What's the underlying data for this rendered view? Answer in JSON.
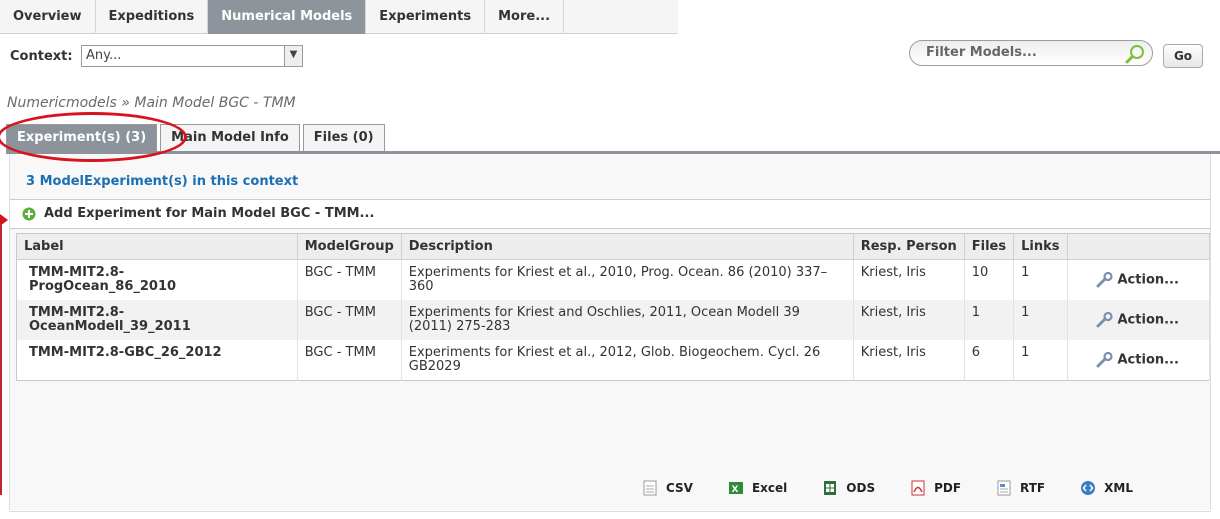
{
  "nav": {
    "tabs": [
      {
        "label": "Overview",
        "active": false
      },
      {
        "label": "Expeditions",
        "active": false
      },
      {
        "label": "Numerical Models",
        "active": true
      },
      {
        "label": "Experiments",
        "active": false
      },
      {
        "label": "More...",
        "active": false
      }
    ]
  },
  "context": {
    "label": "Context:",
    "selected": "Any...",
    "filter_placeholder": "Filter Models...",
    "go_label": "Go"
  },
  "breadcrumb": "Numericmodels » Main Model BGC - TMM",
  "subtabs": [
    {
      "label": "Experiment(s) (3)",
      "active": true
    },
    {
      "label": "Main Model Info",
      "active": false
    },
    {
      "label": "Files (0)",
      "active": false
    }
  ],
  "panel": {
    "title": "3 ModelExperiment(s) in this context",
    "add_label": "Add Experiment for Main Model BGC - TMM..."
  },
  "table": {
    "columns": [
      "Label",
      "ModelGroup",
      "Description",
      "Resp. Person",
      "Files",
      "Links",
      ""
    ],
    "rows": [
      {
        "label": "TMM-MIT2.8-\nProgOcean_86_2010",
        "group": "BGC - TMM",
        "description": "Experiments for Kriest et al., 2010, Prog. Ocean. 86 (2010) 337–360",
        "person": "Kriest, Iris",
        "files": "10",
        "links": "1",
        "action": "Action..."
      },
      {
        "label": "TMM-MIT2.8-\nOceanModell_39_2011",
        "group": "BGC - TMM",
        "description": "Experiments for Kriest and Oschlies, 2011, Ocean Modell 39 (2011) 275-283",
        "person": "Kriest, Iris",
        "files": "1",
        "links": "1",
        "action": "Action..."
      },
      {
        "label": "TMM-MIT2.8-GBC_26_2012",
        "group": "BGC - TMM",
        "description": "Experiments for Kriest et al., 2012, Glob. Biogeochem. Cycl. 26 GB2029",
        "person": "Kriest, Iris",
        "files": "6",
        "links": "1",
        "action": "Action..."
      }
    ]
  },
  "exports": [
    "CSV",
    "Excel",
    "ODS",
    "PDF",
    "RTF",
    "XML"
  ],
  "colors": {
    "accent_link": "#1a6fb5",
    "active_tab": "#8d949c",
    "annotation": "#d9121f"
  }
}
